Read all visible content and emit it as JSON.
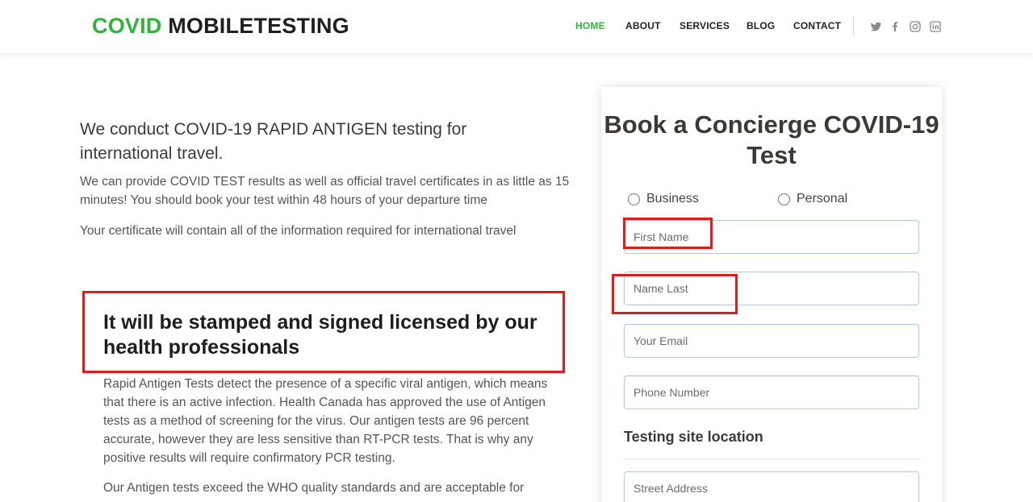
{
  "brand": {
    "accent": "COVID",
    "rest": " MOBILETESTING",
    "accent_color": "#2fb43a"
  },
  "nav": {
    "items": [
      {
        "label": "HOME",
        "active": true
      },
      {
        "label": "ABOUT",
        "active": false
      },
      {
        "label": "SERVICES",
        "active": false
      },
      {
        "label": "BLOG",
        "active": false
      },
      {
        "label": "CONTACT",
        "active": false
      }
    ],
    "social": [
      "twitter-icon",
      "facebook-icon",
      "instagram-icon",
      "linkedin-icon"
    ]
  },
  "intro": {
    "title": "We conduct COVID-19 RAPID ANTIGEN testing for international travel.",
    "p1": "We can provide COVID TEST results as well as official travel certificates in as little as 15 minutes! You should book your test within 48 hours of your departure time",
    "p2": "Your certificate will contain all of the information required for international travel"
  },
  "stamp": {
    "title": "It will be stamped and signed licensed by our health professionals",
    "p1": "Rapid Antigen Tests detect the presence of a specific viral antigen, which means that there is an active infection. Health Canada has approved the use of Antigen tests as a method of screening for the virus. Our antigen tests are 96 percent accurate, however they are less sensitive than RT-PCR tests. That is why any positive results will require confirmatory PCR testing.",
    "p2": "Our Antigen tests exceed the WHO quality standards and are acceptable for"
  },
  "booking": {
    "title": "Book a Concierge COVID-19 Test",
    "radio_business": "Business",
    "radio_personal": "Personal",
    "first_name_placeholder": "First Name",
    "last_name_placeholder": "Name Last",
    "email_placeholder": "Your Email",
    "phone_placeholder": "Phone Number",
    "section_label": "Testing site location",
    "street_placeholder": "Street Address"
  },
  "highlight_color": "#e01b1b"
}
